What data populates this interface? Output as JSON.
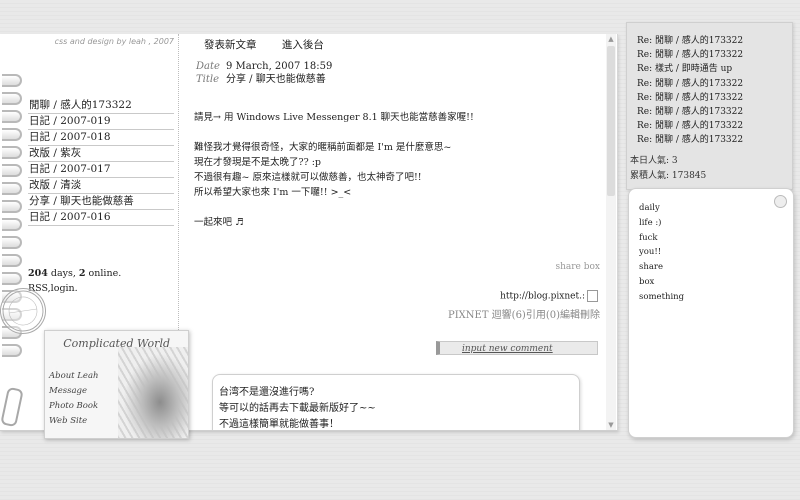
{
  "left": {
    "credit": "css and design by leah , 2007",
    "categories": [
      "閒聊 / 感人的173322",
      "日記 / 2007-019",
      "日記 / 2007-018",
      "改版 / 紫灰",
      "日記 / 2007-017",
      "改版 / 清淡",
      "分享 / 聊天也能做慈善",
      "日記 / 2007-016"
    ],
    "stats": {
      "days": "204",
      "days_label": " days, ",
      "online": "2",
      "online_label": " online.",
      "links": "RSS,login."
    },
    "stamp": "台 灣 2007.04 TAIWAN",
    "card": {
      "title": "Complicated World",
      "links": [
        "About Leah",
        "Message",
        "Photo Book",
        "Web Site"
      ]
    }
  },
  "content": {
    "nav": [
      "發表新文章",
      "進入後台"
    ],
    "date_label": "Date",
    "date": "9 March, 2007 18:59",
    "title_label": "Title",
    "title": "分享 / 聊天也能做慈善",
    "lead": "請見→ 用 Windows Live Messenger 8.1 聊天也能當慈善家喔!!",
    "paragraphs": [
      "難怪我才覺得很奇怪，大家的暱稱前面都是 I'm 是什麼意思~",
      "現在才發現是不是太晚了?? :p",
      "不過很有趣~ 原來這樣就可以做慈善，也太神奇了吧!!",
      "所以希望大家也來 I'm 一下囉!!  >_<"
    ],
    "ending": "一起來吧 ♬",
    "share": "share box",
    "permalink": "http://blog.pixnet.:",
    "tools": "PIXNET 迴響(6)引用(0)編輯刪除",
    "comment_button": "input new comment",
    "comment_lines": [
      "台湾不是還沒進行嗎?",
      "等可以的話再去下載最新版好了~~",
      "不過這樣簡單就能做善事！"
    ]
  },
  "right": {
    "recent": [
      "Re: 閒聊 / 感人的173322",
      "Re: 閒聊 / 感人的173322",
      "Re: 樣式 / 即時通告 up",
      "Re: 閒聊 / 感人的173322",
      "Re: 閒聊 / 感人的173322",
      "Re: 閒聊 / 感人的173322",
      "Re: 閒聊 / 感人的173322",
      "Re: 閒聊 / 感人的173322"
    ],
    "today": "本日人氣: 3",
    "total": "累積人氣: 173845",
    "tags": [
      "daily",
      "life :)",
      "fuck",
      "you!!",
      "share",
      "box",
      "something"
    ]
  }
}
